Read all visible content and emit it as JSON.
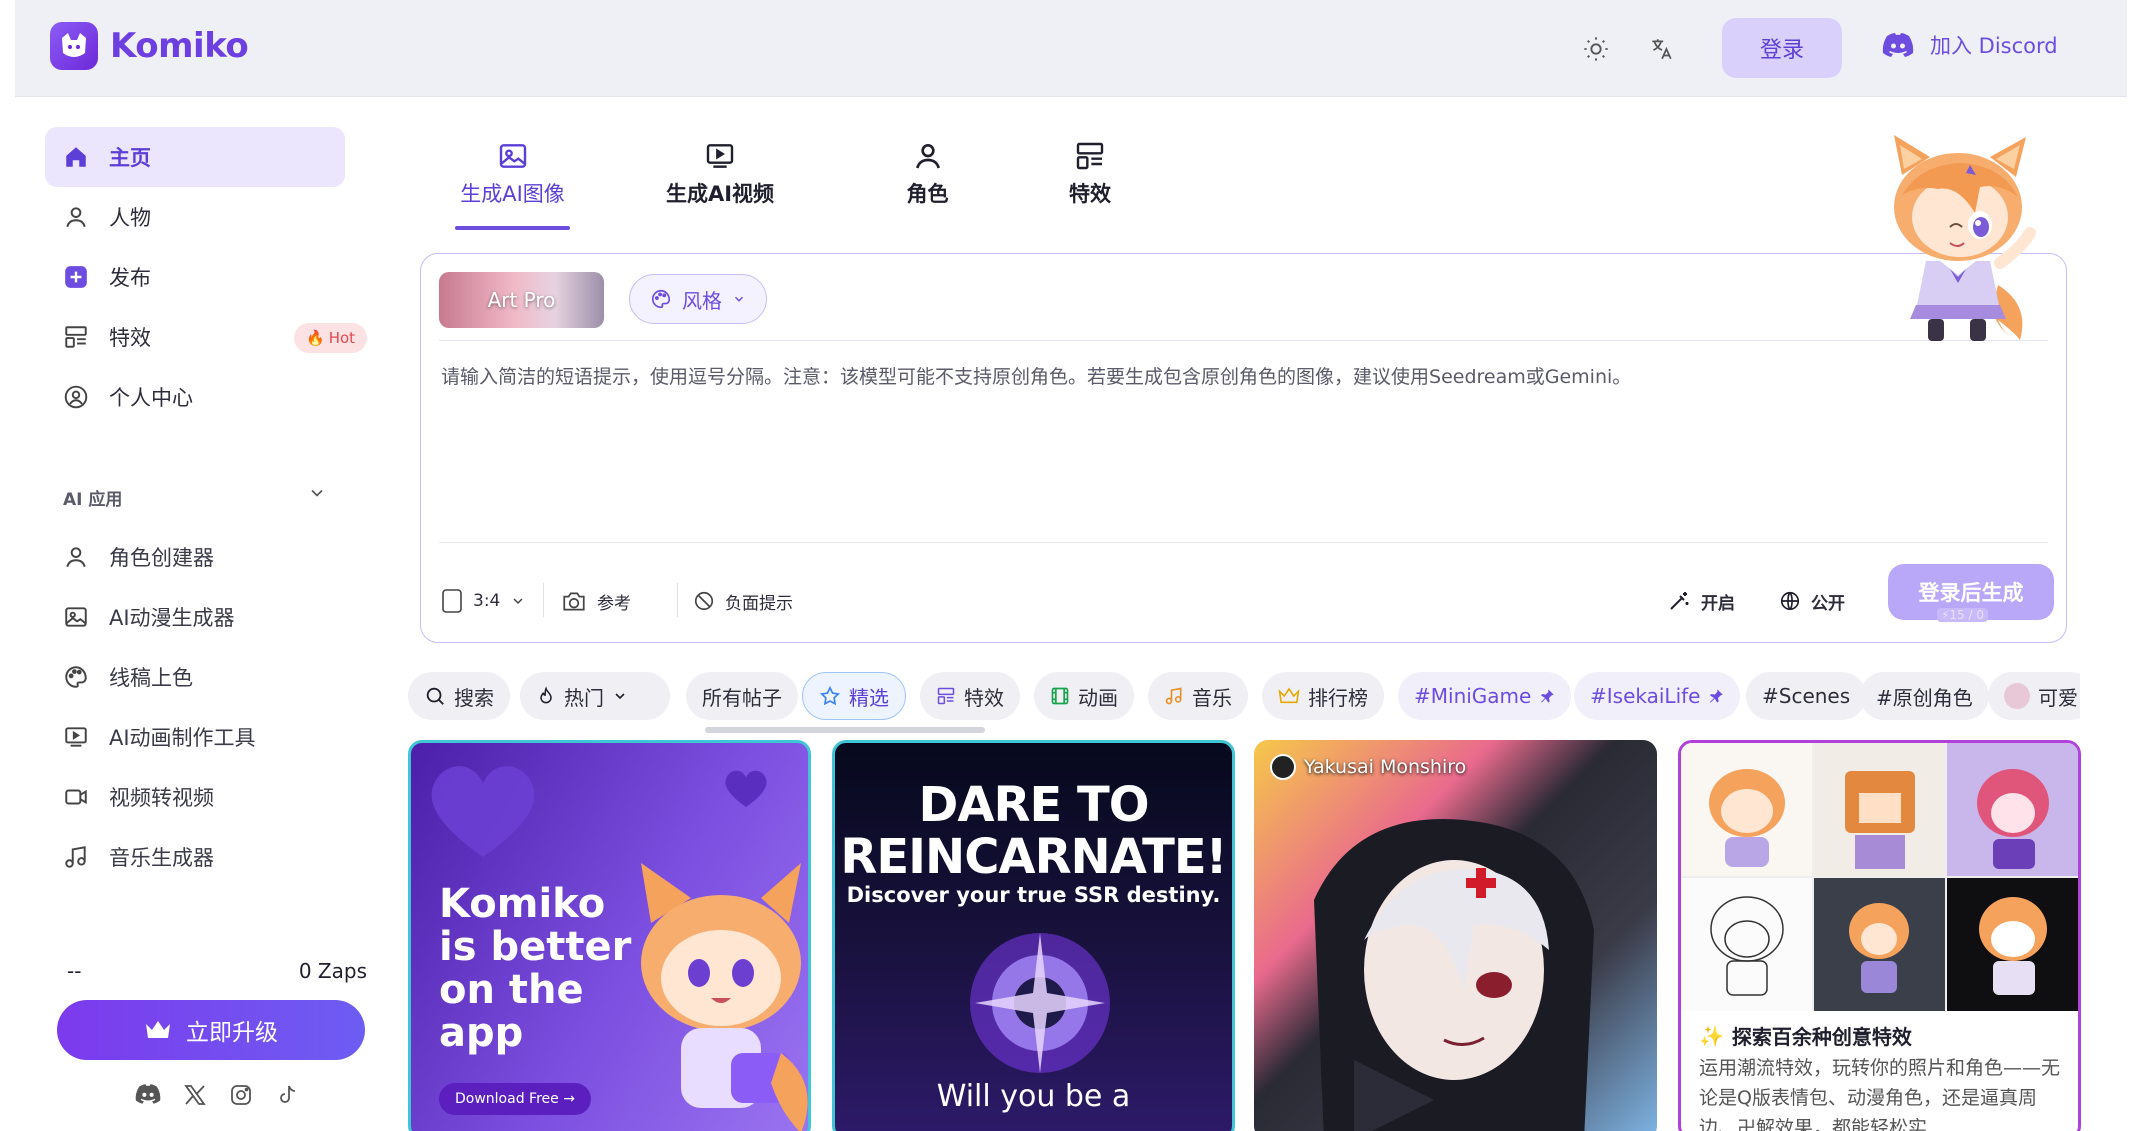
{
  "header": {
    "brand": "Komiko",
    "login_label": "登录",
    "discord_label": "加入 Discord"
  },
  "sidebar": {
    "nav": [
      {
        "label": "主页",
        "icon": "home-icon",
        "active": true
      },
      {
        "label": "人物",
        "icon": "user-icon"
      },
      {
        "label": "发布",
        "icon": "plus-square-icon"
      },
      {
        "label": "特效",
        "icon": "layout-icon",
        "badge": "Hot"
      },
      {
        "label": "个人中心",
        "icon": "user-circle-icon"
      }
    ],
    "section_title": "AI 应用",
    "apps": [
      {
        "label": "角色创建器",
        "icon": "user-icon"
      },
      {
        "label": "AI动漫生成器",
        "icon": "image-icon"
      },
      {
        "label": "线稿上色",
        "icon": "palette-icon"
      },
      {
        "label": "AI动画制作工具",
        "icon": "monitor-play-icon"
      },
      {
        "label": "视频转视频",
        "icon": "video-icon"
      },
      {
        "label": "音乐生成器",
        "icon": "music-icon"
      }
    ],
    "zaps_left": "--",
    "zaps_right": "0 Zaps",
    "upgrade_label": "立即升级"
  },
  "tabs": [
    {
      "label": "生成AI图像",
      "icon": "image-icon",
      "active": true
    },
    {
      "label": "生成AI视频",
      "icon": "video-play-icon"
    },
    {
      "label": "角色",
      "icon": "user-icon"
    },
    {
      "label": "特效",
      "icon": "layout-icon"
    }
  ],
  "prompt": {
    "model_label": "Art Pro",
    "style_label": "风格",
    "placeholder": "请输入简洁的短语提示，使用逗号分隔。注意：该模型可能不支持原创角色。若要生成包含原创角色的图像，建议使用Seedream或Gemini。",
    "ratio": "3:4",
    "reference_label": "参考",
    "negative_label": "负面提示",
    "enhance_label": "开启",
    "visibility_label": "公开",
    "generate_label": "登录后生成",
    "generate_cost": "⚡15 / 0"
  },
  "filters": {
    "search": "搜索",
    "sort": "热门",
    "chips": [
      "所有帖子",
      "精选",
      "特效",
      "动画",
      "音乐",
      "排行榜",
      "#MiniGame",
      "#IsekaiLife",
      "#Scenes",
      "#原创角色",
      "可爱"
    ]
  },
  "cards": {
    "c1_text": [
      "Komiko",
      "is better",
      "on the",
      "app"
    ],
    "c1_download": "Download Free →",
    "c2_title_1": "DARE TO",
    "c2_title_2": "REINCARNATE!",
    "c2_sub": "Discover your true SSR destiny.",
    "c2_bottom": "Will you be a",
    "c3_author": "Yakusai Monshiro",
    "c4_title": "探索百余种创意特效",
    "c4_desc": "运用潮流特效，玩转你的照片和角色——无论是Q版表情包、动漫角色，还是逼真周边、卍解效果，都能轻松实"
  }
}
